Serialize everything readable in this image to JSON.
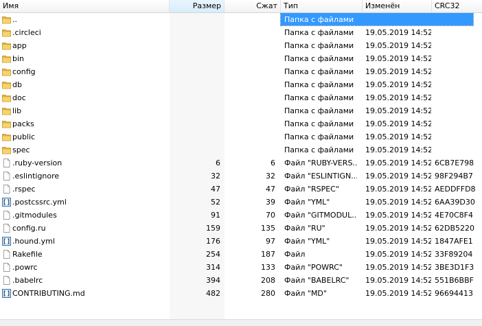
{
  "columns": {
    "name": "Имя",
    "size": "Размер",
    "packed": "Сжат",
    "type": "Тип",
    "modified": "Изменён",
    "crc": "CRC32"
  },
  "rows": [
    {
      "name": "..",
      "size": "",
      "packed": "",
      "type": "Папка с файлами",
      "modified": "",
      "crc": "",
      "icon": "folder-icon",
      "selected": true
    },
    {
      "name": ".circleci",
      "size": "",
      "packed": "",
      "type": "Папка с файлами",
      "modified": "19.05.2019 14:52",
      "crc": "",
      "icon": "folder-icon"
    },
    {
      "name": "app",
      "size": "",
      "packed": "",
      "type": "Папка с файлами",
      "modified": "19.05.2019 14:52",
      "crc": "",
      "icon": "folder-icon"
    },
    {
      "name": "bin",
      "size": "",
      "packed": "",
      "type": "Папка с файлами",
      "modified": "19.05.2019 14:52",
      "crc": "",
      "icon": "folder-icon"
    },
    {
      "name": "config",
      "size": "",
      "packed": "",
      "type": "Папка с файлами",
      "modified": "19.05.2019 14:52",
      "crc": "",
      "icon": "folder-icon"
    },
    {
      "name": "db",
      "size": "",
      "packed": "",
      "type": "Папка с файлами",
      "modified": "19.05.2019 14:52",
      "crc": "",
      "icon": "folder-icon"
    },
    {
      "name": "doc",
      "size": "",
      "packed": "",
      "type": "Папка с файлами",
      "modified": "19.05.2019 14:52",
      "crc": "",
      "icon": "folder-icon"
    },
    {
      "name": "lib",
      "size": "",
      "packed": "",
      "type": "Папка с файлами",
      "modified": "19.05.2019 14:52",
      "crc": "",
      "icon": "folder-icon"
    },
    {
      "name": "packs",
      "size": "",
      "packed": "",
      "type": "Папка с файлами",
      "modified": "19.05.2019 14:52",
      "crc": "",
      "icon": "folder-icon"
    },
    {
      "name": "public",
      "size": "",
      "packed": "",
      "type": "Папка с файлами",
      "modified": "19.05.2019 14:52",
      "crc": "",
      "icon": "folder-icon"
    },
    {
      "name": "spec",
      "size": "",
      "packed": "",
      "type": "Папка с файлами",
      "modified": "19.05.2019 14:52",
      "crc": "",
      "icon": "folder-icon"
    },
    {
      "name": ".ruby-version",
      "size": "6",
      "packed": "6",
      "type": "Файл \"RUBY-VERS...",
      "modified": "19.05.2019 14:52",
      "crc": "6CB7E798",
      "icon": "file-icon"
    },
    {
      "name": ".eslintignore",
      "size": "32",
      "packed": "32",
      "type": "Файл \"ESLINTIGN...",
      "modified": "19.05.2019 14:52",
      "crc": "98F294B7",
      "icon": "file-icon"
    },
    {
      "name": ".rspec",
      "size": "47",
      "packed": "47",
      "type": "Файл \"RSPEC\"",
      "modified": "19.05.2019 14:52",
      "crc": "AEDDFFD8",
      "icon": "file-icon"
    },
    {
      "name": ".postcssrc.yml",
      "size": "52",
      "packed": "39",
      "type": "Файл \"YML\"",
      "modified": "19.05.2019 14:52",
      "crc": "6AA39D30",
      "icon": "yml-file-icon"
    },
    {
      "name": ".gitmodules",
      "size": "91",
      "packed": "70",
      "type": "Файл \"GITMODUL...",
      "modified": "19.05.2019 14:52",
      "crc": "4E70C8F4",
      "icon": "file-icon"
    },
    {
      "name": "config.ru",
      "size": "159",
      "packed": "135",
      "type": "Файл \"RU\"",
      "modified": "19.05.2019 14:52",
      "crc": "62DB5220",
      "icon": "file-icon"
    },
    {
      "name": ".hound.yml",
      "size": "176",
      "packed": "97",
      "type": "Файл \"YML\"",
      "modified": "19.05.2019 14:52",
      "crc": "1847AFE1",
      "icon": "yml-file-icon"
    },
    {
      "name": "Rakefile",
      "size": "254",
      "packed": "187",
      "type": "Файл",
      "modified": "19.05.2019 14:52",
      "crc": "33F89204",
      "icon": "file-icon"
    },
    {
      "name": ".powrc",
      "size": "314",
      "packed": "133",
      "type": "Файл \"POWRC\"",
      "modified": "19.05.2019 14:52",
      "crc": "3BE3D1F3",
      "icon": "file-icon"
    },
    {
      "name": ".babelrc",
      "size": "394",
      "packed": "208",
      "type": "Файл \"BABELRC\"",
      "modified": "19.05.2019 14:52",
      "crc": "551B6BBF",
      "icon": "file-icon"
    },
    {
      "name": "CONTRIBUTING.md",
      "size": "482",
      "packed": "280",
      "type": "Файл \"MD\"",
      "modified": "19.05.2019 14:52",
      "crc": "96694413",
      "icon": "md-file-icon"
    }
  ]
}
